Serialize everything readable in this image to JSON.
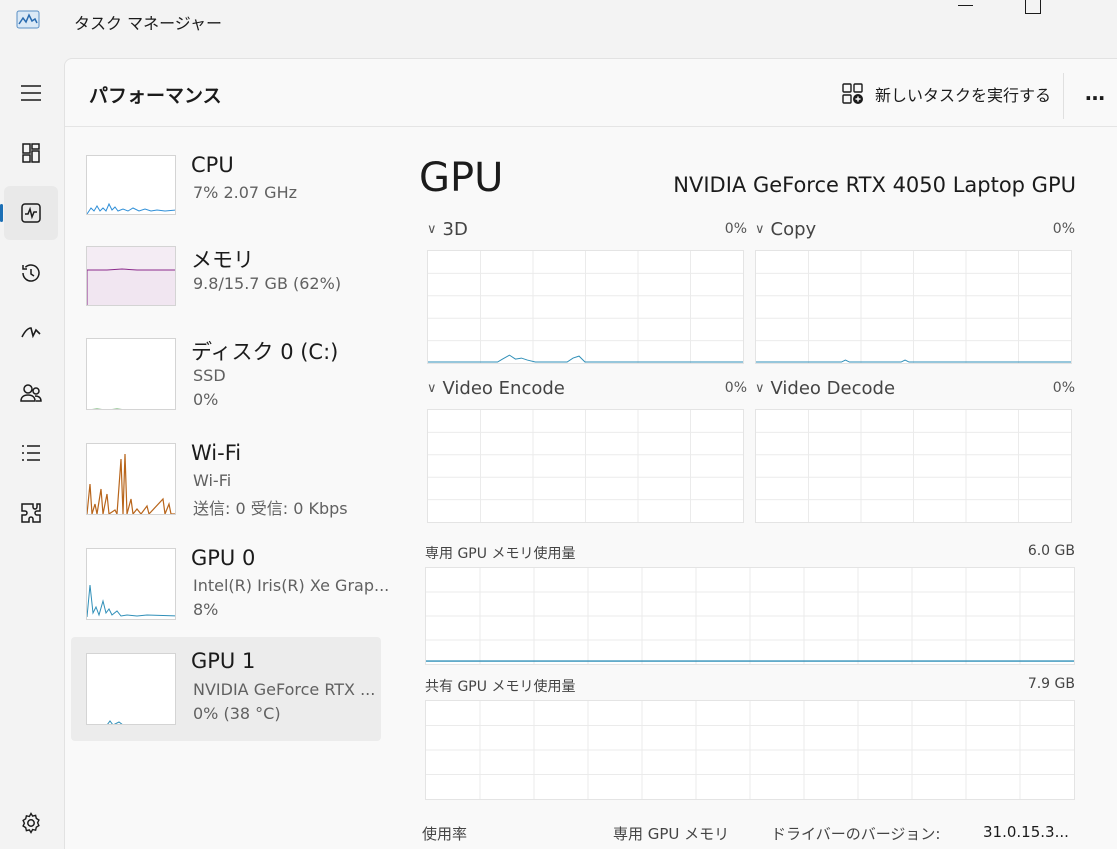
{
  "window": {
    "title": "タスク マネージャー",
    "app_icon": "task-manager-icon"
  },
  "nav": {
    "items": [
      {
        "name": "hamburger-menu",
        "icon": "menu-icon"
      },
      {
        "name": "processes",
        "icon": "processes-icon"
      },
      {
        "name": "performance",
        "icon": "performance-icon",
        "active": true
      },
      {
        "name": "app-history",
        "icon": "history-icon"
      },
      {
        "name": "startup-apps",
        "icon": "startup-icon"
      },
      {
        "name": "users",
        "icon": "users-icon"
      },
      {
        "name": "details",
        "icon": "details-list-icon"
      },
      {
        "name": "services",
        "icon": "services-icon"
      },
      {
        "name": "settings",
        "icon": "gear-icon"
      }
    ],
    "accent_color": "#1c6fb5"
  },
  "header": {
    "title": "パフォーマンス",
    "run_task_label": "新しいタスクを実行する",
    "more_label": "…"
  },
  "devices": [
    {
      "name": "CPU",
      "sub1": "7%  2.07 GHz",
      "sub2": "",
      "color": "#2f8fd8"
    },
    {
      "name": "メモリ",
      "sub1": "9.8/15.7 GB (62%)",
      "sub2": "",
      "color": "#8b2a8b"
    },
    {
      "name": "ディスク 0 (C:)",
      "sub1": "SSD",
      "sub2": "0%",
      "color": "#4ca14c"
    },
    {
      "name": "Wi-Fi",
      "sub1": "Wi-Fi",
      "sub2": "送信: 0  受信: 0 Kbps",
      "color": "#b8651b"
    },
    {
      "name": "GPU 0",
      "sub1": "Intel(R) Iris(R) Xe Grap...",
      "sub2": "8%",
      "color": "#2f8fb8"
    },
    {
      "name": "GPU 1",
      "sub1": "NVIDIA GeForce RTX ...",
      "sub2": "0%  (38 °C)",
      "color": "#2f8fb8",
      "selected": true
    }
  ],
  "detail": {
    "title": "GPU",
    "model": "NVIDIA GeForce RTX 4050 Laptop GPU",
    "engines": [
      {
        "label": "3D",
        "percent": "0%"
      },
      {
        "label": "Copy",
        "percent": "0%"
      },
      {
        "label": "Video Encode",
        "percent": "0%"
      },
      {
        "label": "Video Decode",
        "percent": "0%"
      }
    ],
    "dedicated_memory": {
      "label": "専用 GPU メモリ使用量",
      "value": "6.0 GB"
    },
    "shared_memory": {
      "label": "共有 GPU メモリ使用量",
      "value": "7.9 GB"
    },
    "footer": {
      "usage_label": "使用率",
      "dedicated_label": "専用 GPU メモリ",
      "driver_label": "ドライバーのバージョン:",
      "driver_value": "31.0.15.3..."
    },
    "graph_color": "#2f8fb8"
  }
}
